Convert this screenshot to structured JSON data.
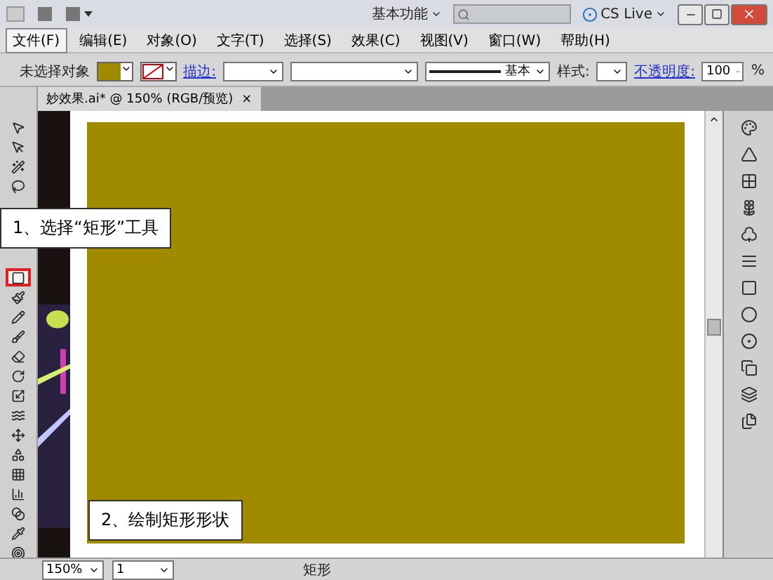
{
  "title_bar": {
    "workspace": "基本功能",
    "cs_live": "CS Live"
  },
  "menu": [
    {
      "label": "文件(F)",
      "selected": true
    },
    {
      "label": "编辑(E)",
      "selected": false
    },
    {
      "label": "对象(O)",
      "selected": false
    },
    {
      "label": "文字(T)",
      "selected": false
    },
    {
      "label": "选择(S)",
      "selected": false
    },
    {
      "label": "效果(C)",
      "selected": false
    },
    {
      "label": "视图(V)",
      "selected": false
    },
    {
      "label": "窗口(W)",
      "selected": false
    },
    {
      "label": "帮助(H)",
      "selected": false
    }
  ],
  "control_bar": {
    "selection": "未选择对象",
    "stroke_label": "描边:",
    "stroke_style": "基本",
    "style_label": "样式:",
    "opacity_label": "不透明度:",
    "opacity": "100",
    "percent": "%"
  },
  "document_tab": {
    "title": "妙效果.ai* @ 150% (RGB/预览)",
    "close": "×"
  },
  "tools_top": [
    {
      "kind": "select",
      "highlighted": false
    },
    {
      "kind": "direct",
      "highlighted": false
    },
    {
      "kind": "wand",
      "highlighted": false
    },
    {
      "kind": "lasso",
      "highlighted": false
    }
  ],
  "tools_bottom": [
    {
      "kind": "rect",
      "highlighted": true
    },
    {
      "kind": "brush",
      "highlighted": false
    },
    {
      "kind": "pencil",
      "highlighted": false
    },
    {
      "kind": "blob",
      "highlighted": false
    },
    {
      "kind": "eraser",
      "highlighted": false
    },
    {
      "kind": "rotate",
      "highlighted": false
    },
    {
      "kind": "scale",
      "highlighted": false
    },
    {
      "kind": "warp",
      "highlighted": false
    },
    {
      "kind": "free",
      "highlighted": false
    },
    {
      "kind": "shape",
      "highlighted": false
    },
    {
      "kind": "grid",
      "highlighted": false
    },
    {
      "kind": "graph",
      "highlighted": false
    },
    {
      "kind": "gradient",
      "highlighted": false
    },
    {
      "kind": "eyedropper",
      "highlighted": false
    },
    {
      "kind": "blend",
      "highlighted": false
    }
  ],
  "callouts": [
    {
      "text": "1、选择“矩形”工具"
    },
    {
      "text": "2、绘制矩形形状"
    }
  ],
  "status_bar": {
    "zoom": "150%",
    "page": "1",
    "tool": "矩形"
  }
}
